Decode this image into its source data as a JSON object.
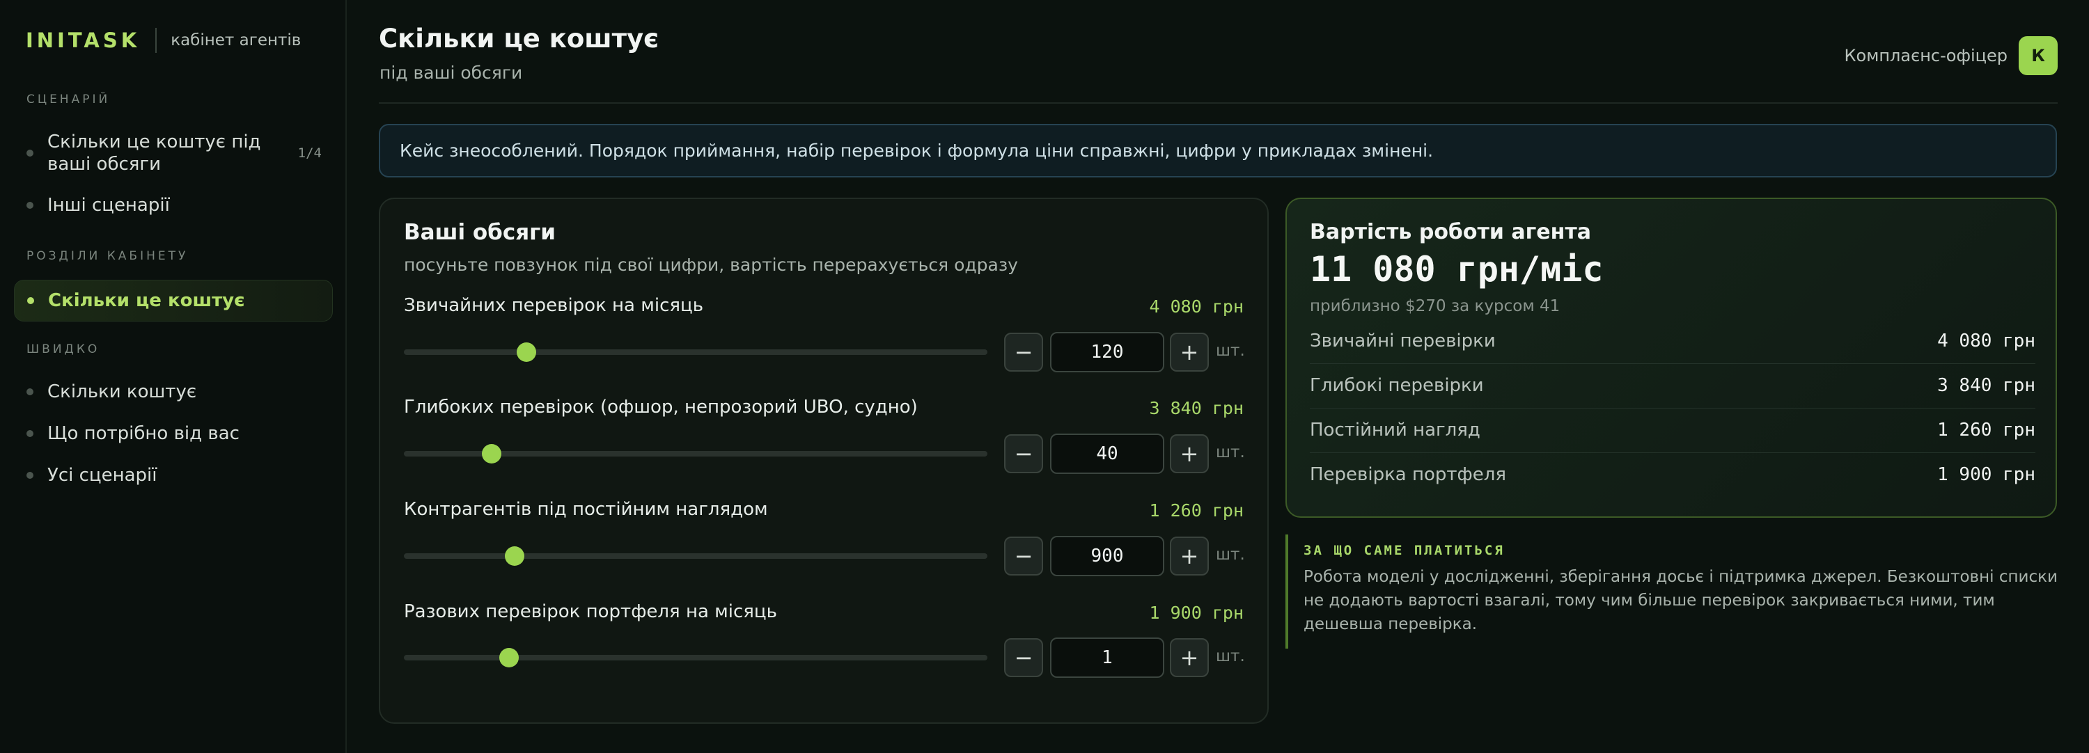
{
  "sidebar": {
    "brand": "INITASK",
    "brand_sub": "кабінет агентів",
    "sections": [
      {
        "label": "СЦЕНАРІЙ"
      },
      {
        "label": "РОЗДІЛИ КАБІНЕТУ"
      },
      {
        "label": "ШВИДКО"
      }
    ],
    "scenario_items": [
      {
        "label_line1": "Скільки це коштує під",
        "label_line2": "ваші обсяги",
        "count": "1/4"
      },
      {
        "label": "Інші сценарії"
      }
    ],
    "cabinet_items": [
      {
        "label": "Скільки це коштує"
      }
    ],
    "quick_items": [
      {
        "label": "Скільки коштує"
      },
      {
        "label": "Що потрібно від вас"
      },
      {
        "label": "Усі сценарії"
      }
    ]
  },
  "header": {
    "title": "Скільки це коштує",
    "subtitle": "під ваші обсяги",
    "user_role": "Комплаєнс-офіцер",
    "avatar_letter": "К"
  },
  "notice": "Кейс знеособлений. Порядок приймання, набір перевірок і формула ціни справжні, цифри у прикладах змінені.",
  "volumes": {
    "title": "Ваші обсяги",
    "subtitle": "посуньте повзунок під свої цифри, вартість перерахується одразу",
    "unit": "шт.",
    "minus": "−",
    "plus": "+",
    "rows": [
      {
        "label": "Звичайних перевірок на місяць",
        "price": "4 080 грн",
        "value": "120",
        "slider_fraction": 0.21
      },
      {
        "label": "Глибоких перевірок (офшор, непрозорий UBO, судно)",
        "price": "3 840 грн",
        "value": "40",
        "slider_fraction": 0.15
      },
      {
        "label": "Контрагентів під постійним наглядом",
        "price": "1 260 грн",
        "value": "900",
        "slider_fraction": 0.19
      },
      {
        "label": "Разових перевірок портфеля на місяць",
        "price": "1 900 грн",
        "value": "1",
        "slider_fraction": 0.18
      }
    ]
  },
  "cost": {
    "title": "Вартість роботи агента",
    "total": "11 080 грн/міс",
    "approx": "приблизно $270 за курсом 41",
    "rows": [
      {
        "label": "Звичайні перевірки",
        "value": "4 080 грн"
      },
      {
        "label": "Глибокі перевірки",
        "value": "3 840 грн"
      },
      {
        "label": "Постійний нагляд",
        "value": "1 260 грн"
      },
      {
        "label": "Перевірка портфеля",
        "value": "1 900 грн"
      }
    ]
  },
  "note": {
    "label": "ЗА ЩО САМЕ ПЛАТИТЬСЯ",
    "text": "Робота моделі у дослідженні, зберігання досьє і підтримка джерел. Безкоштовні списки не додають вартості взагалі, тому чим більше перевірок закривається ними, тим дешевша перевірка."
  }
}
